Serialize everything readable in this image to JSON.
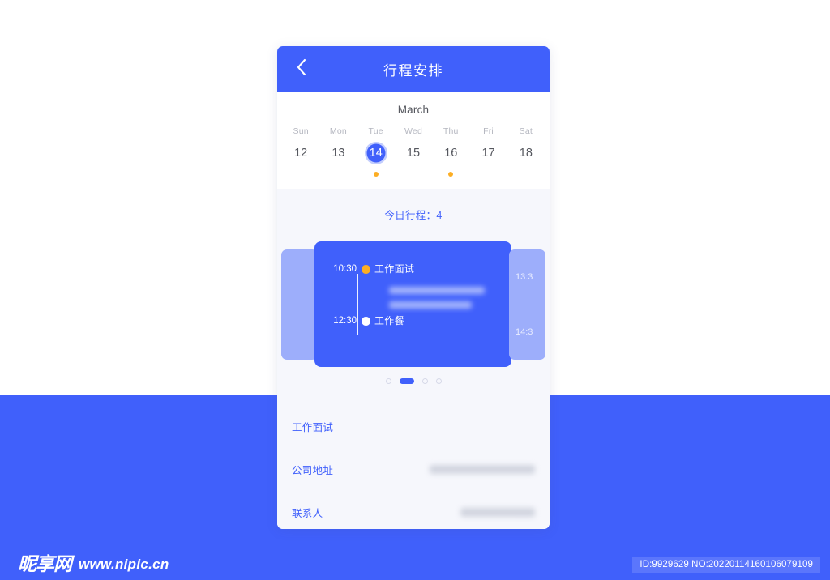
{
  "header": {
    "title": "行程安排",
    "back_icon": "chevron-left-icon"
  },
  "calendar": {
    "month": "March",
    "days": [
      {
        "dow": "Sun",
        "num": "12",
        "selected": false,
        "has_event": false
      },
      {
        "dow": "Mon",
        "num": "13",
        "selected": false,
        "has_event": false
      },
      {
        "dow": "Tue",
        "num": "14",
        "selected": true,
        "has_event": true
      },
      {
        "dow": "Wed",
        "num": "15",
        "selected": false,
        "has_event": false
      },
      {
        "dow": "Thu",
        "num": "16",
        "selected": false,
        "has_event": true
      },
      {
        "dow": "Fri",
        "num": "17",
        "selected": false,
        "has_event": false
      },
      {
        "dow": "Sat",
        "num": "18",
        "selected": false,
        "has_event": false
      }
    ]
  },
  "schedule": {
    "today_count_text": "今日行程：4",
    "peek_left": {
      "times": []
    },
    "peek_right": {
      "times": [
        "13:3",
        "14:3"
      ]
    },
    "main_card": {
      "start_time": "10:30",
      "start_title": "工作面试",
      "end_time": "12:30",
      "end_title": "工作餐",
      "detail_lines_blurred": 2
    },
    "pager": {
      "count": 4,
      "active_index": 1
    }
  },
  "details": {
    "rows": [
      {
        "label": "工作面试",
        "value": ""
      },
      {
        "label": "公司地址",
        "value": ""
      },
      {
        "label": "联系人",
        "value": ""
      }
    ]
  },
  "watermark": {
    "logo_text": "昵享网",
    "url": "www.nipic.cn",
    "id_badge": "ID:9929629 NO:20220114160106079109"
  },
  "colors": {
    "brand_blue": "#4060fb",
    "light_blue_card": "#9daefb",
    "accent_orange": "#fcae24",
    "panel_bg": "#f6f7fc",
    "text_gray": "#55575e",
    "muted_gray": "#b5b7c0"
  }
}
